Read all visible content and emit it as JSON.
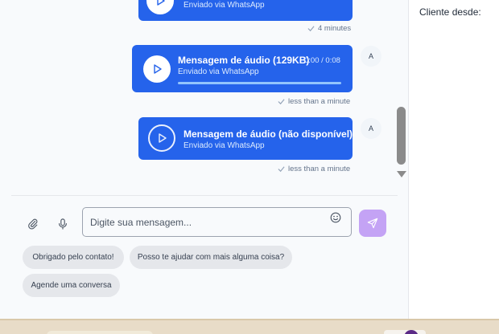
{
  "contact_panel": {
    "client_since_label": "Cliente desde:"
  },
  "messages": [
    {
      "title": "",
      "subtitle": "Enviado via WhatsApp",
      "status": "4 minutes",
      "avatar": ""
    },
    {
      "title": "Mensagem de áudio (129KB)",
      "time": "0:00 / 0:08",
      "subtitle": "Enviado via WhatsApp",
      "status": "less than a minute",
      "avatar": "A",
      "progress": 0
    },
    {
      "title": "Mensagem de áudio (não disponível)",
      "subtitle": "Enviado via WhatsApp",
      "status": "less than a minute",
      "avatar": "A"
    }
  ],
  "composer": {
    "placeholder": "Digite sua mensagem..."
  },
  "quick_replies": [
    "Obrigado pelo contato!",
    "Posso te ajudar com mais alguma coisa?",
    "Agende uma conversa"
  ],
  "colors": {
    "bubble": "#2563eb",
    "send": "#c4a3f5",
    "chip": "#e5e7eb"
  }
}
